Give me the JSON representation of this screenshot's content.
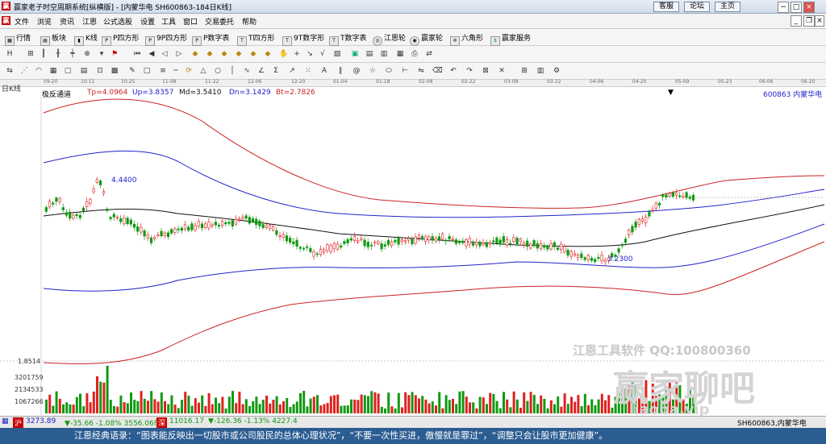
{
  "window": {
    "title": "赢家老子时空周期系统[纵横版] - [内蒙华电  SH600863-184日K线]",
    "top_links": [
      "客服",
      "论坛",
      "主页"
    ]
  },
  "menu": [
    "文件",
    "浏览",
    "资讯",
    "江恩",
    "公式选股",
    "设置",
    "工具",
    "窗口",
    "交易委托",
    "帮助"
  ],
  "toolbar": [
    "行情",
    "板块",
    "K线",
    "P四方形",
    "9P四方形",
    "P数字表",
    "T四方形",
    "9T数字形",
    "T数字表",
    "江恩轮",
    "赢家轮",
    "六角形",
    "赢家服务"
  ],
  "chart": {
    "period": "日K线",
    "indicator": "极反通道",
    "params": [
      "Tp=4.0964",
      "Up=3.8357",
      "Md=3.5410",
      "Dn=3.1429",
      "Bt=2.7826"
    ],
    "stock": "600863 内蒙华电",
    "dates": [
      "09-20",
      "10-11",
      "10-25",
      "11-08",
      "11-22",
      "12-06",
      "12-20",
      "01-04",
      "01-18",
      "02-08",
      "02-22",
      "03-08",
      "03-22",
      "04-06",
      "04-20",
      "05-09",
      "05-23",
      "06-06",
      "06-20"
    ],
    "high_label": "4.4400",
    "low_label": "3.2300",
    "vol_axis": [
      "1.8514",
      "3201759",
      "2134533",
      "1067266"
    ],
    "colors": {
      "top_band": "#cc2222",
      "mid_band": "#2222cc",
      "center": "#111111",
      "up": "#e02020",
      "down": "#119911"
    }
  },
  "chart_data": {
    "type": "candlestick",
    "title": "",
    "series": [
      {
        "name": "Tp",
        "value": 4.0964
      },
      {
        "name": "Up",
        "value": 3.8357
      },
      {
        "name": "Md",
        "value": 3.541
      },
      {
        "name": "Dn",
        "value": 3.1429
      },
      {
        "name": "Bt",
        "value": 2.7826
      }
    ],
    "annotations": [
      "4.4400",
      "3.2300"
    ]
  },
  "status": {
    "sh_index": "3273.89",
    "sh_change": "▼-35.66 -1.08% 3556.06亿",
    "sz_index": "11016.17",
    "sz_change": "▼-126.36 -1.13% 4227.4",
    "symbol": "SH600863,内蒙华电"
  },
  "quote": "江恩经典语录：“图表能反映出一切股市或公司股民的总体心理状况”，“不要一次性买进，傲慢就是罪过”，“调整只会让股市更加健康”。",
  "watermark": {
    "company": "江恩工具软件  QQ:100800360",
    "brand": "赢家聊吧",
    "url": "liaoba.vip"
  }
}
